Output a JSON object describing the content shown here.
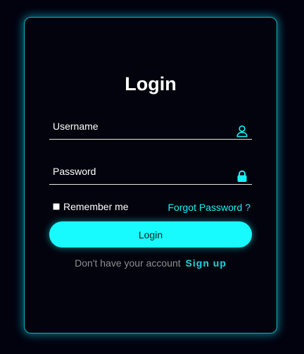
{
  "form": {
    "title": "Login",
    "username_label": "Username",
    "username_icon": "user-icon",
    "password_label": "Password",
    "password_icon": "lock-icon",
    "remember_label": "Remember me",
    "forgot_label": "Forgot Password ?",
    "login_button": "Login",
    "signup_prompt": "Don't have your account",
    "signup_link": "Sign up"
  },
  "colors": {
    "accent": "#18fbfe",
    "background": "#02020f",
    "text": "#ffffff",
    "muted": "#8f8f8f"
  }
}
